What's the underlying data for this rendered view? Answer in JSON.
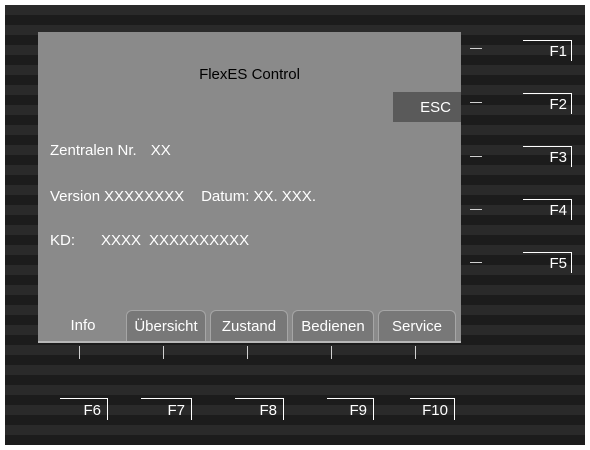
{
  "screen": {
    "title": "FlexES Control",
    "esc_label": "ESC",
    "info": {
      "zentralen_label": "Zentralen Nr.",
      "zentralen_value": "XX",
      "version_label": "Version",
      "version_value": "XXXXXXXX",
      "datum_label": "Datum:",
      "datum_value": "XX. XXX.",
      "kd_label": "KD:",
      "kd_value1": "XXXX",
      "kd_value2": "XXXXXXXXXX"
    },
    "tabs": [
      {
        "label": "Info",
        "active": true
      },
      {
        "label": "Übersicht",
        "active": false
      },
      {
        "label": "Zustand",
        "active": false
      },
      {
        "label": "Bedienen",
        "active": false
      },
      {
        "label": "Service",
        "active": false
      }
    ]
  },
  "function_keys": {
    "right": [
      "F1",
      "F2",
      "F3",
      "F4",
      "F5"
    ],
    "bottom": [
      "F6",
      "F7",
      "F8",
      "F9",
      "F10"
    ]
  }
}
